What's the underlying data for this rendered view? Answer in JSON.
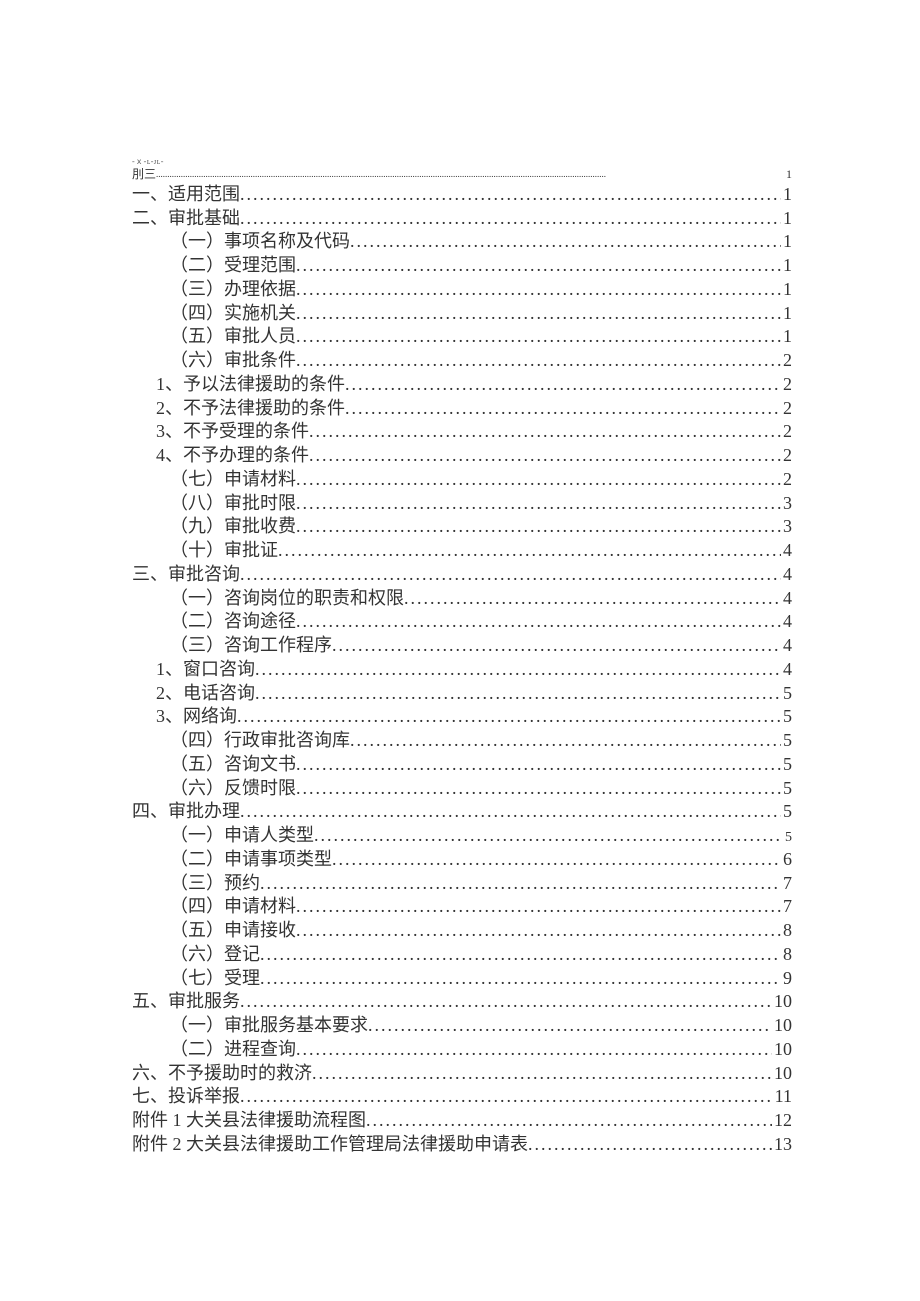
{
  "preHeader": "-ｘ-ʟ-ᴊʟ-",
  "toc": [
    {
      "label": "刖三",
      "page": "1",
      "indent": 0,
      "first": true
    },
    {
      "label": "一、适用范围",
      "page": "1",
      "indent": 0
    },
    {
      "label": "二、审批基础",
      "page": "1",
      "indent": 0
    },
    {
      "label": "（一）事项名称及代码",
      "page": "1",
      "indent": 1
    },
    {
      "label": "（二）受理范围",
      "page": "1",
      "indent": 1
    },
    {
      "label": "（三）办理依据",
      "page": "1",
      "indent": 1
    },
    {
      "label": "（四）实施机关",
      "page": "1",
      "indent": 1
    },
    {
      "label": "（五）审批人员",
      "page": "1",
      "indent": 1
    },
    {
      "label": "（六）审批条件",
      "page": "2",
      "indent": 1
    },
    {
      "label": "1、予以法律援助的条件",
      "page": "2",
      "indent": 2
    },
    {
      "label": "2、不予法律援助的条件",
      "page": "2",
      "indent": 2
    },
    {
      "label": "3、不予受理的条件",
      "page": "2",
      "indent": 2
    },
    {
      "label": "4、不予办理的条件",
      "page": "2",
      "indent": 2
    },
    {
      "label": "（七）申请材料",
      "page": "2",
      "indent": 1
    },
    {
      "label": "（八）审批时限",
      "page": "3",
      "indent": 1
    },
    {
      "label": "（九）审批收费",
      "page": "3",
      "indent": 1
    },
    {
      "label": "（十）审批证",
      "page": "4",
      "indent": 1
    },
    {
      "label": "三、审批咨询",
      "page": "4",
      "indent": 0
    },
    {
      "label": "（一）咨询岗位的职责和权限",
      "page": "4",
      "indent": 1
    },
    {
      "label": "（二）咨询途径",
      "page": "4",
      "indent": 1
    },
    {
      "label": "（三）咨询工作程序",
      "page": "4",
      "indent": 1
    },
    {
      "label": "1、窗口咨询",
      "page": "4",
      "indent": 2
    },
    {
      "label": "2、电话咨询",
      "page": "5",
      "indent": 2
    },
    {
      "label": "3、网络询",
      "page": "5",
      "indent": 2
    },
    {
      "label": "（四）行政审批咨询库",
      "page": "5",
      "indent": 1
    },
    {
      "label": "（五）咨询文书",
      "page": "5",
      "indent": 1
    },
    {
      "label": "（六）反馈时限",
      "page": "5",
      "indent": 1
    },
    {
      "label": "四、审批办理",
      "page": "5",
      "indent": 0
    },
    {
      "label": "（一）申请人类型 ",
      "page": "5",
      "indent": 1,
      "smallPage": true
    },
    {
      "label": "（二）申请事项类型",
      "page": "6",
      "indent": 1
    },
    {
      "label": "（三）预约",
      "page": "7",
      "indent": 1
    },
    {
      "label": "（四）申请材料",
      "page": "7",
      "indent": 1
    },
    {
      "label": "（五）申请接收",
      "page": "8",
      "indent": 1
    },
    {
      "label": "（六）登记",
      "page": "8",
      "indent": 1
    },
    {
      "label": "（七）受理",
      "page": "9",
      "indent": 1
    },
    {
      "label": "五、审批服务",
      "page": "10",
      "indent": 0
    },
    {
      "label": "（一）审批服务基本要求",
      "page": "10",
      "indent": 1
    },
    {
      "label": "（二）进程查询",
      "page": "10",
      "indent": 1
    },
    {
      "label": "六、不予援助时的救济",
      "page": "10",
      "indent": 0
    },
    {
      "label": "七、投诉举报",
      "page": "11",
      "indent": 0
    },
    {
      "label": "附件 1 大关县法律援助流程图",
      "page": "12",
      "indent": 0
    },
    {
      "label": "附件 2 大关县法律援助工作管理局法律援助申请表",
      "page": "13",
      "indent": 0
    }
  ]
}
